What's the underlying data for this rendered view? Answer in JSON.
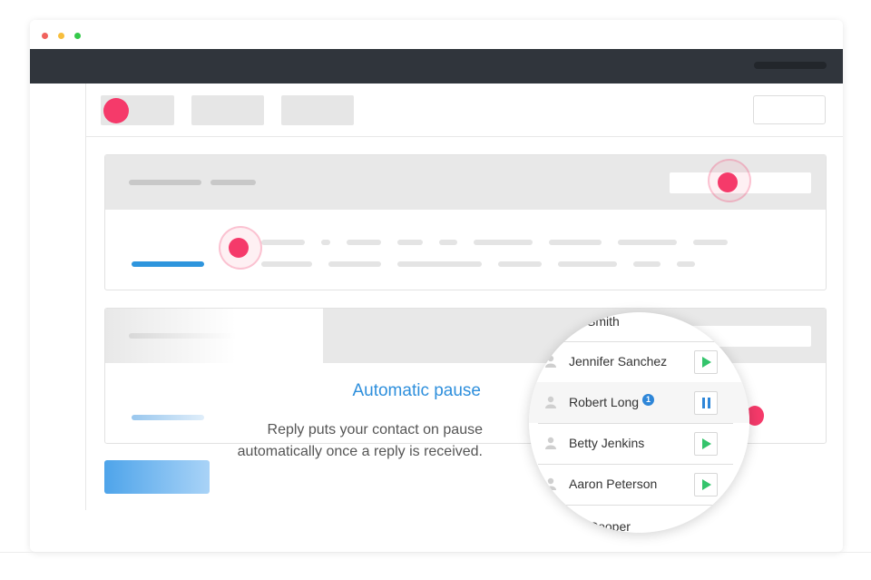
{
  "window": {
    "traffic_lights": [
      {
        "name": "close",
        "color": "#f0625d"
      },
      {
        "name": "minimize",
        "color": "#f7be3c"
      },
      {
        "name": "zoom",
        "color": "#35c94a"
      }
    ]
  },
  "feature": {
    "title": "Automatic pause",
    "description_line1": "Reply puts your contact on pause",
    "description_line2": "automatically once a reply is received."
  },
  "contacts": [
    {
      "name": "Smith",
      "action": "none",
      "badge": ""
    },
    {
      "name": "Jennifer Sanchez",
      "action": "play-icon",
      "badge": ""
    },
    {
      "name": "Robert Long",
      "action": "pause-icon",
      "badge": "1"
    },
    {
      "name": "Betty Jenkins",
      "action": "play-icon",
      "badge": ""
    },
    {
      "name": "Aaron Peterson",
      "action": "play-icon",
      "badge": ""
    },
    {
      "name": "Cooper",
      "action": "none",
      "badge": ""
    }
  ],
  "colors": {
    "accent": "#2e8fdc",
    "hotspot": "#f53a6a",
    "topbar": "#30353c",
    "play": "#34c46c",
    "pause": "#2e86d8"
  }
}
